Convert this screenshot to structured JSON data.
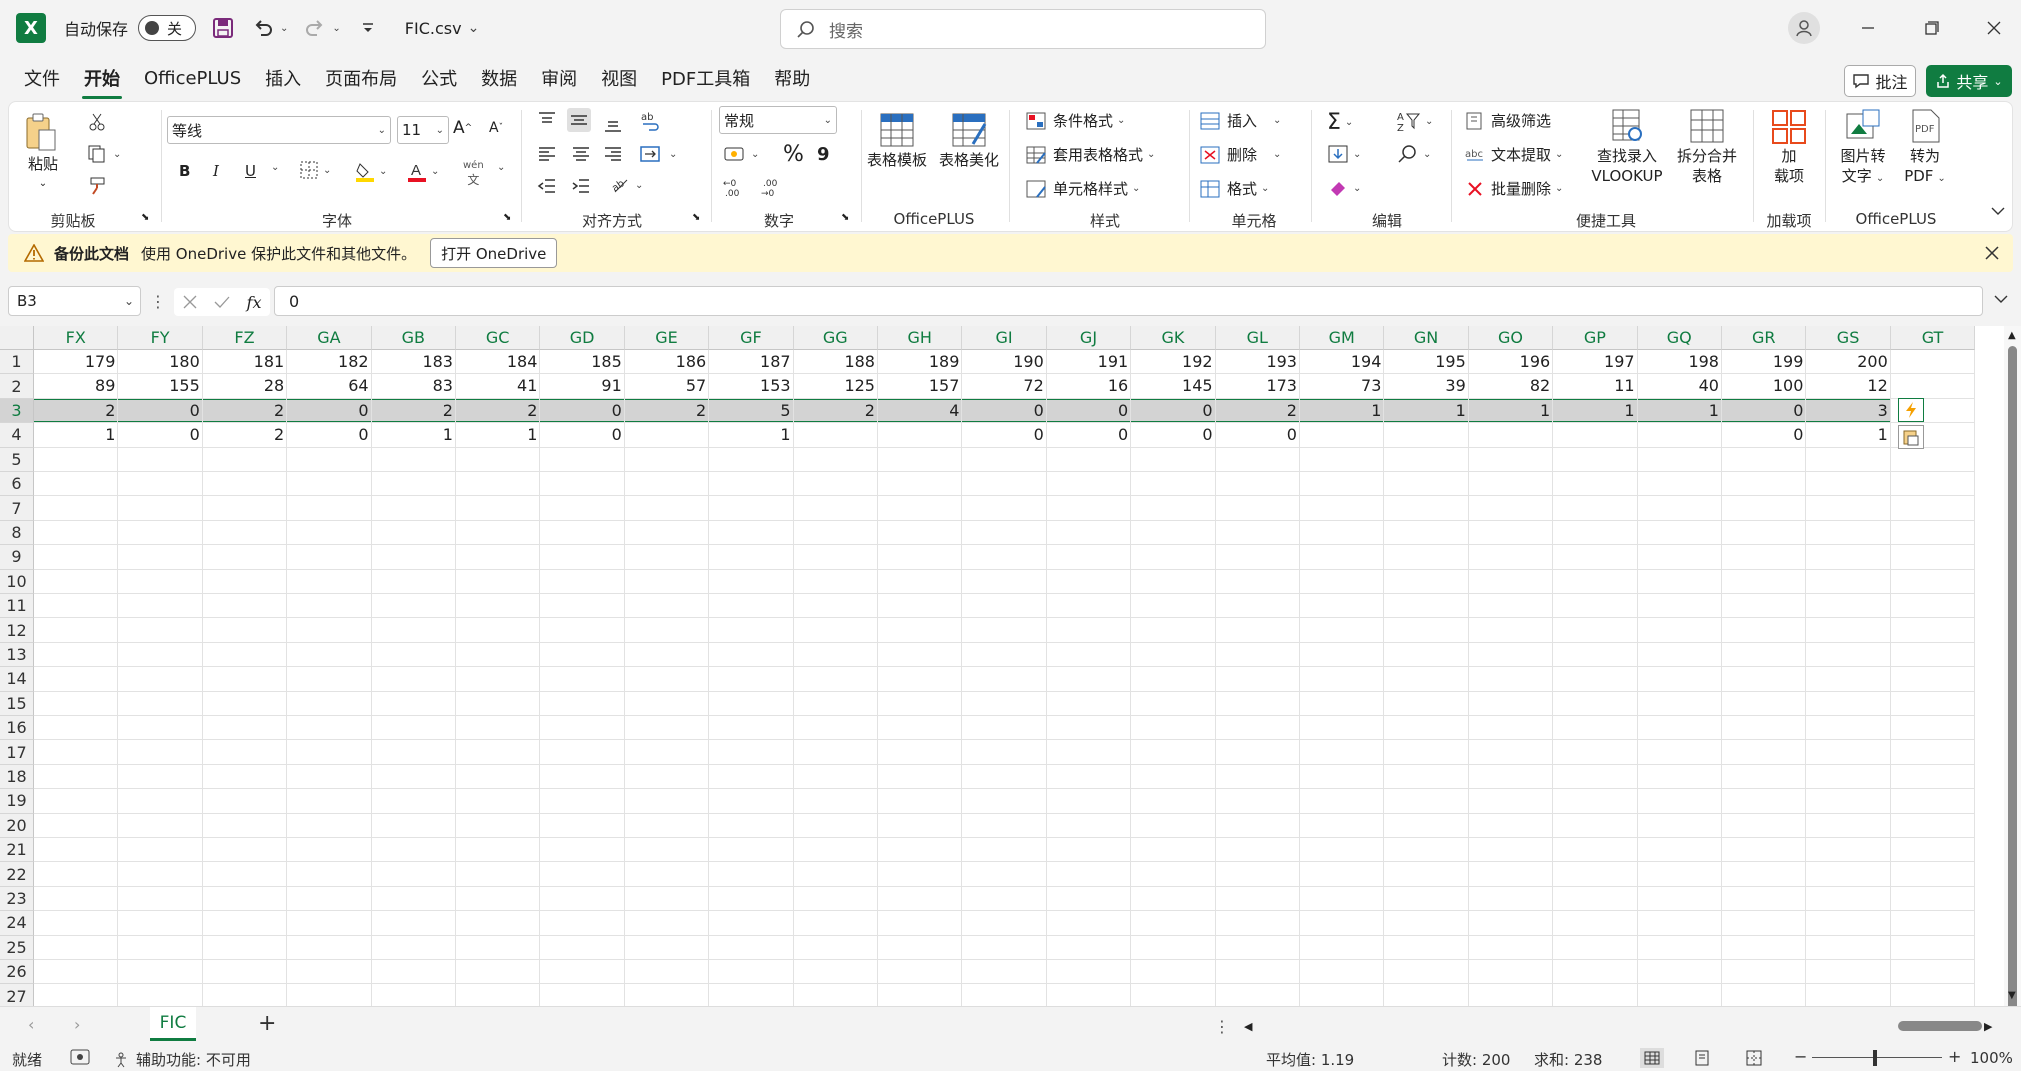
{
  "titlebar": {
    "app_icon": "X",
    "autosave_label": "自动保存",
    "autosave_state": "关",
    "filename": "FIC.csv",
    "search_placeholder": "搜索"
  },
  "menu": {
    "tabs": [
      "文件",
      "开始",
      "OfficePLUS",
      "插入",
      "页面布局",
      "公式",
      "数据",
      "审阅",
      "视图",
      "PDF工具箱",
      "帮助"
    ],
    "active_tab": "开始",
    "comment_label": "批注",
    "share_label": "共享"
  },
  "ribbon": {
    "clipboard": {
      "paste": "粘贴",
      "label": "剪贴板"
    },
    "font": {
      "name": "等线",
      "size": "11",
      "label": "字体",
      "bold": "B",
      "italic": "I",
      "underline": "U",
      "pinyin": "wén"
    },
    "align": {
      "label": "对齐方式"
    },
    "number": {
      "format": "常规",
      "label": "数字",
      "percent": "%",
      "comma": "9"
    },
    "officeplus1": {
      "template": "表格模板",
      "beautify": "表格美化",
      "label": "OfficePLUS"
    },
    "styles": {
      "conditional": "条件格式",
      "table_format": "套用表格格式",
      "cell_style": "单元格样式",
      "label": "样式"
    },
    "cells": {
      "insert": "插入",
      "delete": "删除",
      "format": "格式",
      "label": "单元格"
    },
    "editing": {
      "label": "编辑"
    },
    "tools": {
      "advanced_filter": "高级筛选",
      "text_extract": "文本提取",
      "batch_delete": "批量删除",
      "lookup_line1": "查找录入",
      "lookup_line2": "VLOOKUP",
      "split_line1": "拆分合并",
      "split_line2": "表格",
      "label": "便捷工具"
    },
    "addins": {
      "line1": "加",
      "line2": "载项",
      "label": "加载项"
    },
    "officeplus2": {
      "img_line1": "图片转",
      "img_line2": "文字",
      "pdf_line1": "转为",
      "pdf_line2": "PDF",
      "label": "OfficePLUS"
    }
  },
  "infobar": {
    "title": "备份此文档",
    "message": "使用 OneDrive 保护此文件和其他文件。",
    "button": "打开 OneDrive"
  },
  "formula_bar": {
    "name_box": "B3",
    "fx": "fx",
    "value": "0"
  },
  "sheet": {
    "columns": [
      "FX",
      "FY",
      "FZ",
      "GA",
      "GB",
      "GC",
      "GD",
      "GE",
      "GF",
      "GG",
      "GH",
      "GI",
      "GJ",
      "GK",
      "GL",
      "GM",
      "GN",
      "GO",
      "GP",
      "GQ",
      "GR",
      "GS",
      "GT"
    ],
    "rows": [
      [
        "179",
        "180",
        "181",
        "182",
        "183",
        "184",
        "185",
        "186",
        "187",
        "188",
        "189",
        "190",
        "191",
        "192",
        "193",
        "194",
        "195",
        "196",
        "197",
        "198",
        "199",
        "200",
        ""
      ],
      [
        "89",
        "155",
        "28",
        "64",
        "83",
        "41",
        "91",
        "57",
        "153",
        "125",
        "157",
        "72",
        "16",
        "145",
        "173",
        "73",
        "39",
        "82",
        "11",
        "40",
        "100",
        "12",
        ""
      ],
      [
        "2",
        "0",
        "2",
        "0",
        "2",
        "2",
        "0",
        "2",
        "5",
        "2",
        "4",
        "0",
        "0",
        "0",
        "2",
        "1",
        "1",
        "1",
        "1",
        "1",
        "0",
        "3",
        ""
      ],
      [
        "1",
        "0",
        "2",
        "0",
        "1",
        "1",
        "0",
        "",
        "1",
        "",
        "",
        "0",
        "0",
        "0",
        "0",
        "",
        "",
        "",
        "",
        "",
        "0",
        "1",
        ""
      ]
    ],
    "row_numbers": [
      "1",
      "2",
      "3",
      "4",
      "5",
      "6",
      "7",
      "8",
      "9",
      "10",
      "11",
      "12",
      "13",
      "14",
      "15",
      "16",
      "17",
      "18",
      "19",
      "20",
      "21",
      "22",
      "23",
      "24",
      "25",
      "26",
      "27"
    ],
    "selected_row": 3,
    "tab_name": "FIC"
  },
  "statusbar": {
    "ready": "就绪",
    "accessibility": "辅助功能: 不可用",
    "average": "平均值: 1.19",
    "count": "计数: 200",
    "sum": "求和: 238",
    "zoom": "100%"
  },
  "colors": {
    "accent": "#107c41",
    "info_bg": "#fff7d1",
    "selected_row": "#d3d3d3"
  }
}
